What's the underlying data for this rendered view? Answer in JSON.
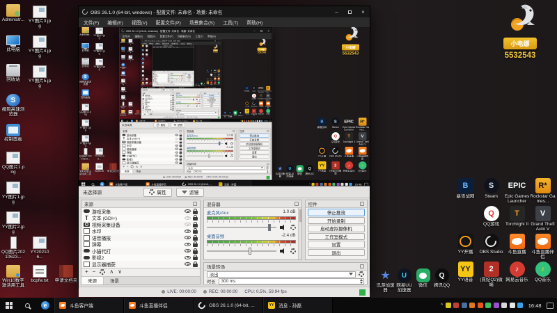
{
  "overlay": {
    "badge_text": "小电娜",
    "room_id": "5532543"
  },
  "obs": {
    "title": "OBS 26.1.0 (64-bit, windows) - 配置文件: 未命名 - 场景: 未命名",
    "menu": [
      {
        "key": "file",
        "label": "文件(F)"
      },
      {
        "key": "edit",
        "label": "编辑(E)"
      },
      {
        "key": "view",
        "label": "视图(V)"
      },
      {
        "key": "profile",
        "label": "配置文件(P)"
      },
      {
        "key": "scene-collection",
        "label": "场景集合(S)"
      },
      {
        "key": "tools",
        "label": "工具(T)"
      },
      {
        "key": "help",
        "label": "帮助(H)"
      }
    ],
    "source_toolbar": {
      "no_source_label": "未选择源",
      "properties_label": "属性",
      "filters_label": "滤镜"
    },
    "sources_dock": {
      "title": "来源",
      "items": [
        {
          "key": "game-capture",
          "label": "游戏采集",
          "icon": "game",
          "visible": true
        },
        {
          "key": "text-gdi",
          "label": "文本 (GDI+)",
          "icon": "text",
          "visible": false
        },
        {
          "key": "video-capture-device",
          "label": "视频采集设备",
          "icon": "cam",
          "visible": false
        },
        {
          "key": "watermark",
          "label": "水印",
          "icon": "file",
          "visible": true
        },
        {
          "key": "voice-broadcast",
          "label": "语音播报",
          "icon": "file",
          "visible": true
        },
        {
          "key": "danmaku",
          "label": "弹幕",
          "icon": "file",
          "visible": true
        },
        {
          "key": "xiaomao-daida",
          "label": "小猫代打",
          "icon": "game",
          "visible": true
        },
        {
          "key": "yingshi-2",
          "label": "影视2",
          "icon": "game",
          "visible": true
        },
        {
          "key": "display-capture",
          "label": "显示器捕获",
          "icon": "file",
          "visible": true
        }
      ],
      "footer_icons": [
        "add",
        "remove",
        "properties",
        "move-up",
        "move-down"
      ],
      "tabs": [
        {
          "key": "sources",
          "label": "来源",
          "active": true
        },
        {
          "key": "scenes",
          "label": "场景",
          "active": false
        }
      ]
    },
    "mixer_dock": {
      "title": "混音器",
      "channels": [
        {
          "key": "mic-aux",
          "name": "麦克风/Aux",
          "db": "1.0 dB",
          "slider_pos": 0.9
        },
        {
          "key": "desktop-audio",
          "name": "桌面音频",
          "db": "-2.4 dB",
          "slider_pos": 0.62
        }
      ]
    },
    "transitions_dock": {
      "title": "场景转场",
      "transition": "淡出",
      "duration_label": "时长",
      "duration_value": "300 ms"
    },
    "controls_dock": {
      "title": "控件",
      "buttons": [
        {
          "key": "stop-streaming",
          "label": "停止推流",
          "primary": true
        },
        {
          "key": "start-recording",
          "label": "开始录制",
          "primary": false
        },
        {
          "key": "start-virtual-camera",
          "label": "启动虚拟摄像机",
          "primary": false
        },
        {
          "key": "studio-mode",
          "label": "工作室模式",
          "primary": false
        },
        {
          "key": "settings",
          "label": "设置",
          "primary": false
        },
        {
          "key": "exit",
          "label": "退出",
          "primary": false
        }
      ]
    },
    "status_bar": {
      "live": "LIVE: 00:00:00",
      "rec": "REC: 00:00:00",
      "cpu": "CPU: 0.5%, 59.94 fps"
    }
  },
  "desktop": {
    "col1": [
      {
        "key": "administrator",
        "label": "Administr...",
        "icon": "folder-user"
      },
      {
        "key": "this-pc",
        "label": "此电脑",
        "icon": "monitor"
      },
      {
        "key": "recycle-bin",
        "label": "回收站",
        "icon": "bin"
      },
      {
        "key": "sogou-browser",
        "label": "搜狗高速浏览器",
        "icon": "sogou"
      },
      {
        "key": "control-panel",
        "label": "控制面板",
        "icon": "panel"
      }
    ],
    "col2": [
      {
        "key": "yy-image-3",
        "label": "YY图片3.jpg",
        "icon": "image"
      },
      {
        "key": "yy-image-4",
        "label": "YY图片4.jpg",
        "icon": "image"
      },
      {
        "key": "yy-image-5",
        "label": "YY图片5.jpg",
        "icon": "image"
      }
    ],
    "lower": [
      {
        "key": "qq-image-1",
        "label": "QQ图片1.png",
        "icon": "image"
      },
      {
        "key": "yy-image-1",
        "label": "YY图片1.jpg",
        "icon": "image"
      },
      {
        "key": "yy-image-2",
        "label": "YY图片2.jpg",
        "icon": "image"
      }
    ],
    "lower_row": [
      {
        "key": "qq-image-20210623",
        "label": "QQ图片20210623...",
        "icon": "image-tall"
      },
      {
        "key": "yy-202106",
        "label": "YY202106...",
        "icon": "image"
      }
    ],
    "bottom_row": [
      {
        "key": "win10-activation-tool",
        "label": "Win10数字激活用工具",
        "icon": "folder"
      },
      {
        "key": "bcpfw-txt",
        "label": "bcpfw.txt",
        "icon": "txtfile"
      },
      {
        "key": "shenqing-doc",
        "label": "申请文档夹",
        "icon": "redbook"
      }
    ],
    "right_grid": [
      {
        "key": "battlenet",
        "label": "暴雪战网",
        "icon": "battlenet",
        "empty": false
      },
      {
        "key": "steam",
        "label": "Steam",
        "icon": "steam",
        "empty": false
      },
      {
        "key": "epic-games-launcher",
        "label": "Epic Games Launcher",
        "icon": "epic",
        "empty": false
      },
      {
        "key": "rockstar-games",
        "label": "Rockstar Games...",
        "icon": "rockstar",
        "empty": false
      },
      {
        "key": "empty-cell",
        "label": "",
        "icon": "steam",
        "empty": true
      },
      {
        "key": "qq-game",
        "label": "QQ游戏",
        "icon": "qqgame",
        "empty": false
      },
      {
        "key": "torchlight-2",
        "label": "Torchlight II",
        "icon": "torch",
        "empty": false
      },
      {
        "key": "gta-v",
        "label": "Grand Theft Auto V",
        "icon": "gta",
        "empty": false
      },
      {
        "key": "yy-kaibo",
        "label": "YY开播",
        "icon": "yykb",
        "empty": false
      },
      {
        "key": "obs-studio",
        "label": "OBS Studio",
        "icon": "obsapp",
        "empty": false
      },
      {
        "key": "douyu-live",
        "label": "斗鱼直播",
        "icon": "douyu",
        "empty": false
      },
      {
        "key": "douyu-companion",
        "label": "斗鱼直播伴侣",
        "icon": "douyu",
        "empty": false
      },
      {
        "key": "yy-voice",
        "label": "YY语音",
        "icon": "yyvoice",
        "empty": false
      },
      {
        "key": "xifei-q2",
        "label": "(熹妃Q2)微端",
        "icon": "xifei",
        "empty": false
      },
      {
        "key": "netease-music",
        "label": "网易云音乐",
        "icon": "netease",
        "empty": false
      },
      {
        "key": "qq-music",
        "label": "QQ音乐",
        "icon": "qqmusic",
        "empty": false
      }
    ],
    "mid_row": [
      {
        "key": "xunyou-accelerator",
        "label": "迅游加速器",
        "icon": "xunyou"
      },
      {
        "key": "uu-accelerator",
        "label": "网易UU加速器",
        "icon": "uu"
      },
      {
        "key": "wechat",
        "label": "微信",
        "icon": "wechat"
      },
      {
        "key": "tencent-qq",
        "label": "腾讯QQ",
        "icon": "qq"
      }
    ]
  },
  "taskbar": {
    "buttons": [
      {
        "key": "douyu-client",
        "label": "斗鱼客户端",
        "icon": "douyu"
      },
      {
        "key": "douyu-companion",
        "label": "斗鱼直播伴侣",
        "icon": "douyu"
      },
      {
        "key": "obs",
        "label": "OBS 26.1.0 (64-bit, ...",
        "icon": "obsapp"
      },
      {
        "key": "message-sunlei",
        "label": "消息 - 孙磊",
        "icon": "yyvoice"
      }
    ],
    "tray": [
      {
        "key": "yy-tray-icon",
        "color": "#d6c81f"
      },
      {
        "key": "security-tray-icon",
        "color": "#c04038"
      },
      {
        "key": "uu-tray-icon",
        "color": "#4a6f9e"
      },
      {
        "key": "douyu-tray-icon",
        "color": "#e07820"
      },
      {
        "key": "douyu-companion-tray-icon",
        "color": "#e8581c"
      },
      {
        "key": "upload-status-tray-icon",
        "color": "#3dbf5f"
      },
      {
        "key": "graphics-tray-icon",
        "color": "#9a4fd0"
      },
      {
        "key": "headset-tray-icon",
        "color": "#d8d8d8"
      },
      {
        "key": "volume-tray-icon",
        "color": "#e8e8e8"
      },
      {
        "key": "bluetooth-tray-icon",
        "color": "#3aa0e8"
      }
    ],
    "time": "16:48"
  }
}
